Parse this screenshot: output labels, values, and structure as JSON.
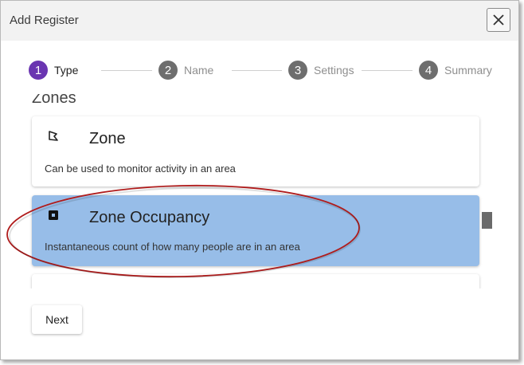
{
  "dialog": {
    "title": "Add Register",
    "close_icon": "close-icon"
  },
  "stepper": {
    "steps": [
      {
        "number": "1",
        "label": "Type",
        "active": true
      },
      {
        "number": "2",
        "label": "Name",
        "active": false
      },
      {
        "number": "3",
        "label": "Settings",
        "active": false
      },
      {
        "number": "4",
        "label": "Summary",
        "active": false
      }
    ],
    "active_color": "#6a35b1",
    "inactive_color": "#6e6e6e"
  },
  "list": {
    "group_heading": "Zones",
    "items": [
      {
        "title": "Zone",
        "description": "Can be used to monitor activity in an area",
        "icon": "zone-polygon-icon",
        "selected": false
      },
      {
        "title": "Zone Occupancy",
        "description": "Instantaneous count of how many people are in an area",
        "icon": "zone-occupancy-icon",
        "selected": true
      },
      {
        "title": "",
        "description": "",
        "icon": "partial-item-icon",
        "selected": false
      }
    ],
    "selected_color": "#97bde8"
  },
  "annotation": {
    "color": "#b01c1c"
  },
  "footer": {
    "next_label": "Next"
  }
}
